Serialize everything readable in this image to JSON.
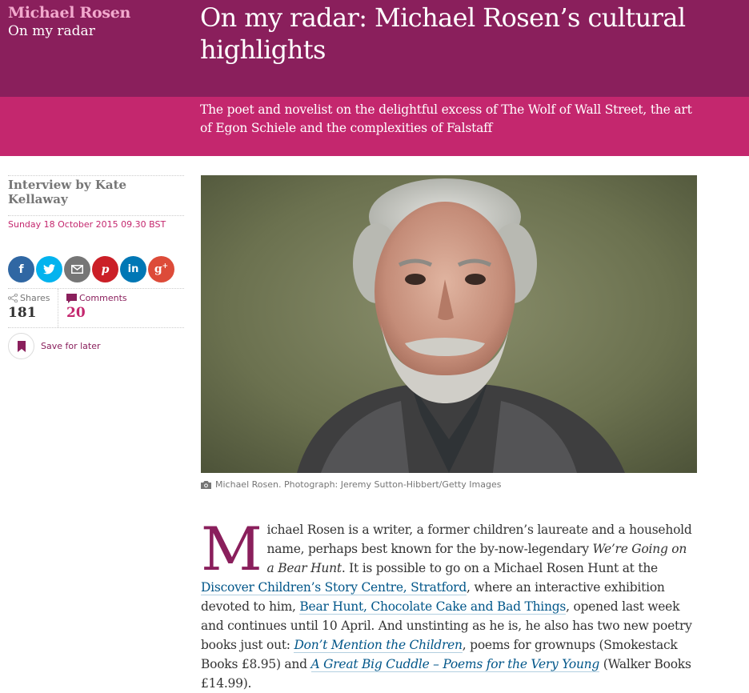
{
  "header": {
    "kicker": "Michael Rosen",
    "series": "On my radar",
    "headline": "On my radar: Michael Rosen’s cultural highlights",
    "standfirst": "The poet and novelist on the delightful excess of The Wolf of Wall Street, the art of Egon Schiele and the complexities of Falstaff",
    "colors": {
      "dark": "#8a1f5c",
      "bright": "#c4276e",
      "kicker": "#f2a9cd"
    }
  },
  "meta": {
    "byline": "Interview by Kate Kellaway",
    "date": "Sunday 18 October 2015 09.30 BST",
    "share_buttons": [
      {
        "icon": "facebook-icon",
        "glyph": "f",
        "color": "#3067a3"
      },
      {
        "icon": "twitter-icon",
        "glyph": "t",
        "color": "#03b3ee"
      },
      {
        "icon": "email-icon",
        "glyph": "✉",
        "color": "#767676"
      },
      {
        "icon": "pinterest-icon",
        "glyph": "p",
        "color": "#cb1f27"
      },
      {
        "icon": "linkedin-icon",
        "glyph": "in",
        "color": "#0077b5"
      },
      {
        "icon": "googleplus-icon",
        "glyph": "g+",
        "color": "#dd4b39"
      }
    ],
    "shares_label": "Shares",
    "shares_count": "181",
    "comments_label": "Comments",
    "comments_count": "20",
    "save_label": "Save for later"
  },
  "image": {
    "caption": "Michael Rosen. Photograph: Jeremy Sutton-Hibbert/Getty Images"
  },
  "article": {
    "dropcap": "M",
    "p1_a": "ichael Rosen is a writer, a former children’s laureate and a household name, perhaps best known for the by-now-legendary ",
    "p1_em1": "We’re Going on a Bear Hunt",
    "p1_b": ". It is possible to go on a Michael Rosen Hunt at the ",
    "p1_link1": "Discover Children’s Story Centre, Stratford",
    "p1_c": ", where an interactive exhibition devoted to him, ",
    "p1_link2": "Bear Hunt, Chocolate Cake and Bad Things",
    "p1_d": ", opened last week and continues until 10 April. And unstinting as he is, he also has two new poetry books just out: ",
    "p1_link3": "Don’t Mention the Children",
    "p1_e": ", poems for grownups (Smokestack Books £8.95) and ",
    "p1_link4": "A Great Big Cuddle – Poems for the Very Young",
    "p1_f": " (Walker Books £14.99)."
  }
}
